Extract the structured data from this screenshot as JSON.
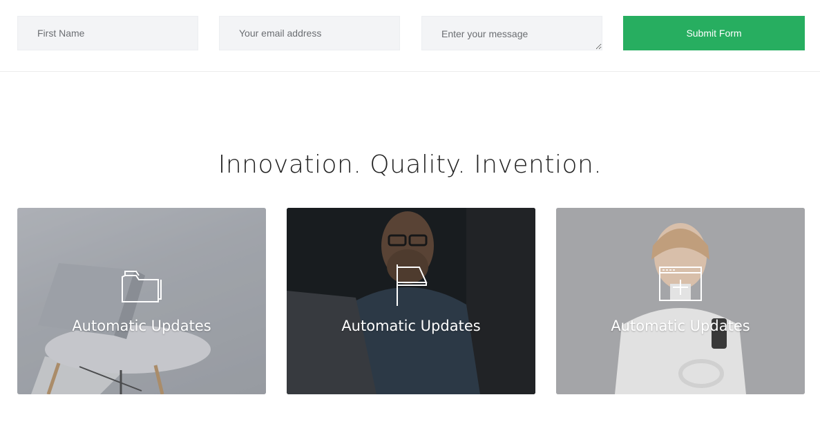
{
  "form": {
    "first_name_placeholder": "First Name",
    "email_placeholder": "Your email address",
    "message_placeholder": "Enter your message",
    "submit_label": "Submit Form"
  },
  "section": {
    "heading": "Innovation. Quality. Invention."
  },
  "cards": [
    {
      "icon": "folder-icon",
      "title": "Automatic Updates"
    },
    {
      "icon": "flag-icon",
      "title": "Automatic Updates"
    },
    {
      "icon": "browser-add-icon",
      "title": "Automatic Updates"
    }
  ],
  "colors": {
    "accent": "#27ae60",
    "field_bg": "#f3f4f6"
  }
}
